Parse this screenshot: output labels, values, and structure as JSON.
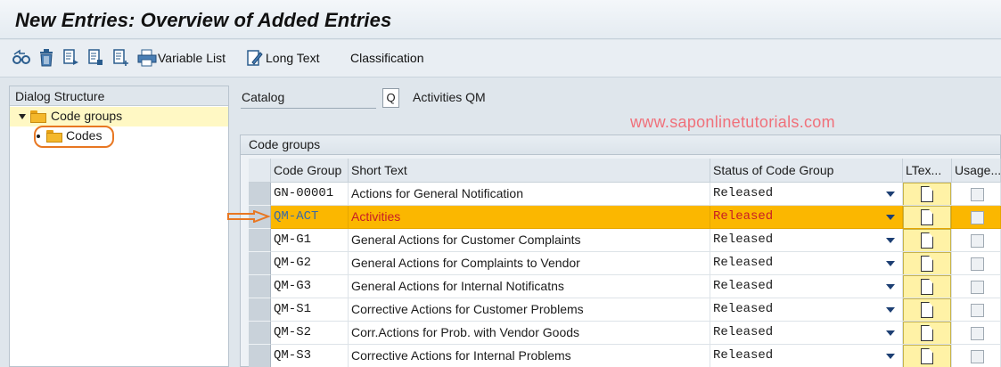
{
  "title": "New Entries: Overview of Added Entries",
  "toolbar": {
    "icons": [
      "glasses-change-icon",
      "delete-icon",
      "copy-icon",
      "save-icon",
      "page-icon",
      "print-icon",
      "edit-long-text-icon"
    ],
    "variable_list": "Variable List",
    "long_text": "Long Text",
    "classification": "Classification"
  },
  "dialog_structure": {
    "header": "Dialog Structure",
    "items": [
      {
        "label": "Code groups",
        "level": 0,
        "expanded": true,
        "selected": true
      },
      {
        "label": "Codes",
        "level": 1,
        "expanded": false,
        "selected": false
      }
    ]
  },
  "catalog": {
    "label": "Catalog",
    "value": "Q",
    "description": "Activities QM"
  },
  "watermark": "www.saponlinetutorials.com",
  "code_groups": {
    "header": "Code groups",
    "columns": [
      "Code Group",
      "Short Text",
      "Status of Code Group",
      "LTex...",
      "Usage..."
    ],
    "rows": [
      {
        "code": "GN-00001",
        "text": "Actions for General Notification",
        "status": "Released",
        "highlighted": false
      },
      {
        "code": "QM-ACT",
        "text": "Activities",
        "status": "Released",
        "highlighted": true
      },
      {
        "code": "QM-G1",
        "text": "General Actions for Customer Complaints",
        "status": "Released",
        "highlighted": false
      },
      {
        "code": "QM-G2",
        "text": "General Actions for Complaints to Vendor",
        "status": "Released",
        "highlighted": false
      },
      {
        "code": "QM-G3",
        "text": "General Actions for Internal Notificatns",
        "status": "Released",
        "highlighted": false
      },
      {
        "code": "QM-S1",
        "text": "Corrective Actions for Customer Problems",
        "status": "Released",
        "highlighted": false
      },
      {
        "code": "QM-S2",
        "text": "Corr.Actions for Prob. with Vendor Goods",
        "status": "Released",
        "highlighted": false
      },
      {
        "code": "QM-S3",
        "text": "Corrective Actions for Internal Problems",
        "status": "Released",
        "highlighted": false
      }
    ]
  },
  "colors": {
    "highlight_row": "#fbb700",
    "highlight_text": "#c81d25",
    "annotation_orange": "#e87722",
    "watermark": "#f0707a"
  }
}
